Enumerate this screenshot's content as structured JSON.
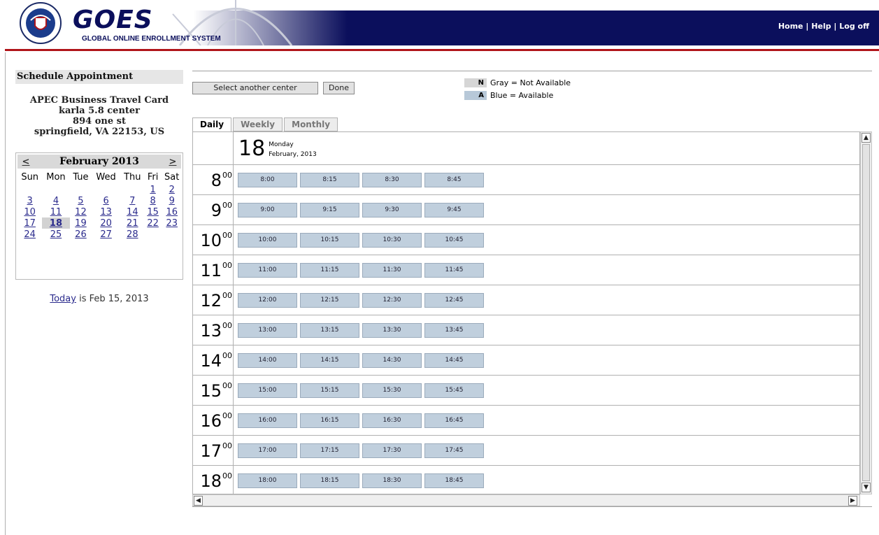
{
  "header": {
    "logo_text": "GOES",
    "logo_subtitle": "GLOBAL ONLINE ENROLLMENT SYSTEM",
    "seal_icon": "dhs-seal-icon",
    "links": [
      "Home",
      "Help",
      "Log off"
    ],
    "separator": "|",
    "colors": {
      "band": "#0b0f5c",
      "rule": "#b0151a"
    }
  },
  "sidebar": {
    "title": "Schedule Appointment",
    "center": {
      "program": "APEC Business Travel Card",
      "name": "karla 5.8 center",
      "street": "894 one st",
      "city": "springfield, VA 22153, US"
    },
    "calendar": {
      "prev": "<",
      "next": ">",
      "month_label": "February 2013",
      "weekdays": [
        "Sun",
        "Mon",
        "Tue",
        "Wed",
        "Thu",
        "Fri",
        "Sat"
      ],
      "weeks": [
        [
          "",
          "",
          "",
          "",
          "",
          "1",
          "2"
        ],
        [
          "3",
          "4",
          "5",
          "6",
          "7",
          "8",
          "9"
        ],
        [
          "10",
          "11",
          "12",
          "13",
          "14",
          "15",
          "16"
        ],
        [
          "17",
          "18",
          "19",
          "20",
          "21",
          "22",
          "23"
        ],
        [
          "24",
          "25",
          "26",
          "27",
          "28",
          "",
          ""
        ]
      ],
      "selected": "18"
    },
    "today": {
      "link": "Today",
      "text": " is Feb 15, 2013"
    }
  },
  "toolbar": {
    "select_center": "Select another center",
    "done": "Done"
  },
  "legend": [
    {
      "code": "N",
      "label": "Gray = Not Available",
      "color": "#d6d6d6"
    },
    {
      "code": "A",
      "label": "Blue = Available",
      "color": "#b7c8d8"
    }
  ],
  "tabs": [
    "Daily",
    "Weekly",
    "Monthly"
  ],
  "active_tab": "Daily",
  "day": {
    "number": "18",
    "weekday": "Monday",
    "month_year": "February, 2013"
  },
  "hour_minutes_label": "00",
  "hours": [
    {
      "hour": "8",
      "slots": [
        "8:00",
        "8:15",
        "8:30",
        "8:45"
      ]
    },
    {
      "hour": "9",
      "slots": [
        "9:00",
        "9:15",
        "9:30",
        "9:45"
      ]
    },
    {
      "hour": "10",
      "slots": [
        "10:00",
        "10:15",
        "10:30",
        "10:45"
      ]
    },
    {
      "hour": "11",
      "slots": [
        "11:00",
        "11:15",
        "11:30",
        "11:45"
      ]
    },
    {
      "hour": "12",
      "slots": [
        "12:00",
        "12:15",
        "12:30",
        "12:45"
      ]
    },
    {
      "hour": "13",
      "slots": [
        "13:00",
        "13:15",
        "13:30",
        "13:45"
      ]
    },
    {
      "hour": "14",
      "slots": [
        "14:00",
        "14:15",
        "14:30",
        "14:45"
      ]
    },
    {
      "hour": "15",
      "slots": [
        "15:00",
        "15:15",
        "15:30",
        "15:45"
      ]
    },
    {
      "hour": "16",
      "slots": [
        "16:00",
        "16:15",
        "16:30",
        "16:45"
      ]
    },
    {
      "hour": "17",
      "slots": [
        "17:00",
        "17:15",
        "17:30",
        "17:45"
      ]
    },
    {
      "hour": "18",
      "slots": [
        "18:00",
        "18:15",
        "18:30",
        "18:45"
      ]
    }
  ],
  "scrollbar": {
    "up": "▲",
    "down": "▼",
    "left": "◀",
    "right": "▶"
  }
}
